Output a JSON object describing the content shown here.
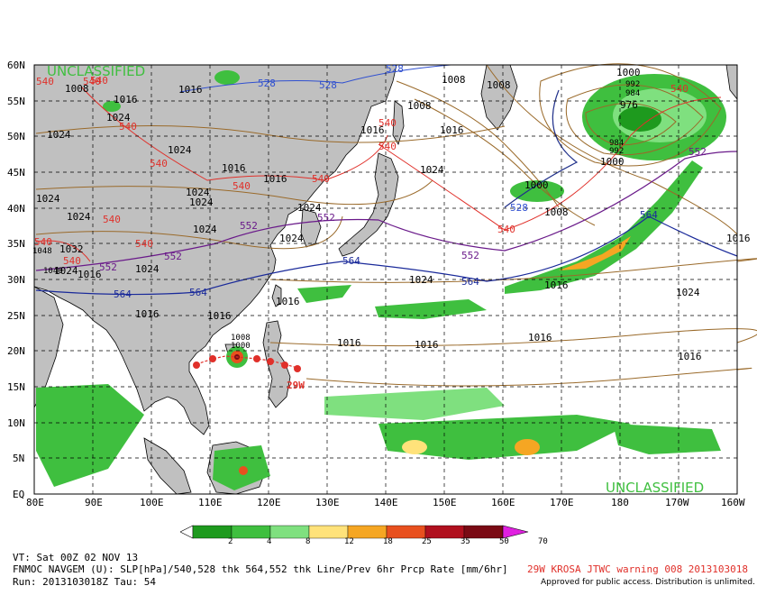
{
  "map": {
    "lat_labels": [
      "60N",
      "55N",
      "50N",
      "45N",
      "40N",
      "35N",
      "30N",
      "25N",
      "20N",
      "15N",
      "10N",
      "5N",
      "EQ"
    ],
    "lon_labels": [
      "80E",
      "90E",
      "100E",
      "110E",
      "120E",
      "130E",
      "140E",
      "150E",
      "160E",
      "170E",
      "180",
      "170W",
      "160W"
    ],
    "classification_top": "UNCLASSIFIED",
    "classification_bottom": "UNCLASSIFIED",
    "storm_label": "29W",
    "slp_labels": [
      "1008",
      "1008",
      "1016",
      "1016",
      "1024",
      "1024",
      "1024",
      "1024",
      "1024",
      "1024",
      "1016",
      "1016",
      "1008",
      "1024",
      "1008",
      "1016",
      "1016",
      "1000",
      "992",
      "984",
      "976",
      "984",
      "992",
      "1000",
      "1000",
      "1008",
      "1024",
      "1016",
      "1024",
      "1016",
      "1016",
      "1016",
      "1016",
      "1008",
      "1000",
      "1024",
      "1024",
      "1032",
      "1048",
      "1040",
      "1016",
      "1024",
      "1024",
      "1016",
      "1016",
      "1016",
      "1016",
      "1024",
      "1024"
    ],
    "thk540_labels": [
      "540",
      "540",
      "540",
      "540",
      "540",
      "540",
      "540",
      "540",
      "540",
      "540",
      "540",
      "540",
      "540",
      "540",
      "540"
    ],
    "thk528_labels": [
      "528",
      "528",
      "528",
      "528"
    ],
    "thk552_labels": [
      "552",
      "552",
      "552",
      "552",
      "552",
      "552"
    ],
    "thk564_labels": [
      "564",
      "564",
      "564",
      "564",
      "564"
    ]
  },
  "legend": {
    "ticks": [
      "2",
      "4",
      "8",
      "12",
      "18",
      "25",
      "35",
      "50",
      "70"
    ],
    "colors": [
      "#1e9a1e",
      "#3fbf3f",
      "#7fe07f",
      "#ffe27a",
      "#f5a623",
      "#e8501e",
      "#b0101e",
      "#7a0a14",
      "#e020e0"
    ]
  },
  "footer": {
    "vt": "VT: Sat 00Z 02 NOV 13",
    "model": "FNMOC NAVGEM (U): SLP[hPa]/540,528 thk 564,552 thk Line/Prev 6hr Prcp Rate [mm/6hr]",
    "run": "Run: 2013103018Z Tau: 54",
    "warning": "29W KROSA JTWC warning 008 2013103018",
    "approved": "Approved for public access. Distribution is unlimited."
  }
}
